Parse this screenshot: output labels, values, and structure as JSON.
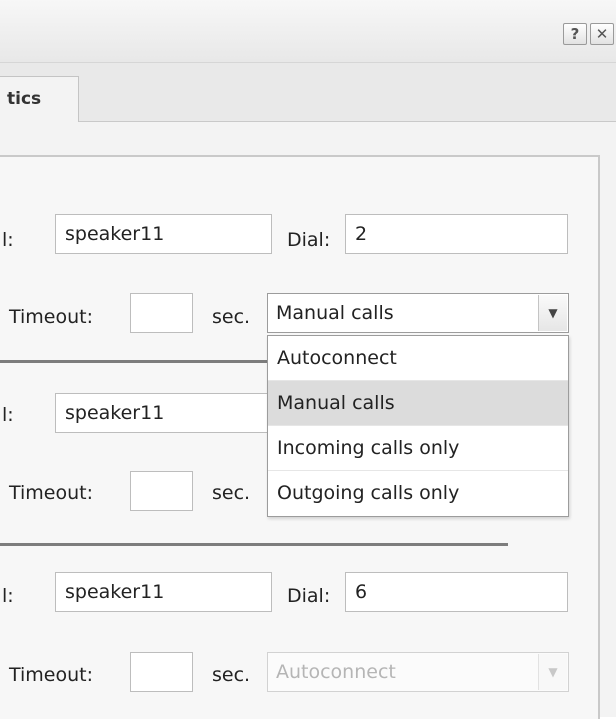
{
  "window": {
    "help_label": "?",
    "close_label": "✕"
  },
  "tab": {
    "label": "tics"
  },
  "rows": [
    {
      "id_label_fragment": "l:",
      "id_value": "speaker11",
      "dial_label": "Dial:",
      "dial_value": "2",
      "timeout_label": "Timeout:",
      "timeout_value": "",
      "sec_label": "sec.",
      "mode_value": "Manual calls",
      "mode_disabled": false
    },
    {
      "id_label_fragment": "l:",
      "id_value": "speaker11",
      "timeout_label": "Timeout:",
      "timeout_value": "",
      "sec_label": "sec."
    },
    {
      "id_label_fragment": "l:",
      "id_value": "speaker11",
      "dial_label": "Dial:",
      "dial_value": "6",
      "timeout_label": "Timeout:",
      "timeout_value": "",
      "sec_label": "sec.",
      "mode_value": "Autoconnect",
      "mode_disabled": true
    }
  ],
  "dropdown": {
    "options": [
      "Autoconnect",
      "Manual calls",
      "Incoming calls only",
      "Outgoing calls only"
    ],
    "selected": "Manual calls"
  },
  "icons": {
    "select_arrow": "chevron-down-icon"
  },
  "colors": {
    "selected_option_bg": "#dcdcdc",
    "divider": "#7d7d7d"
  }
}
